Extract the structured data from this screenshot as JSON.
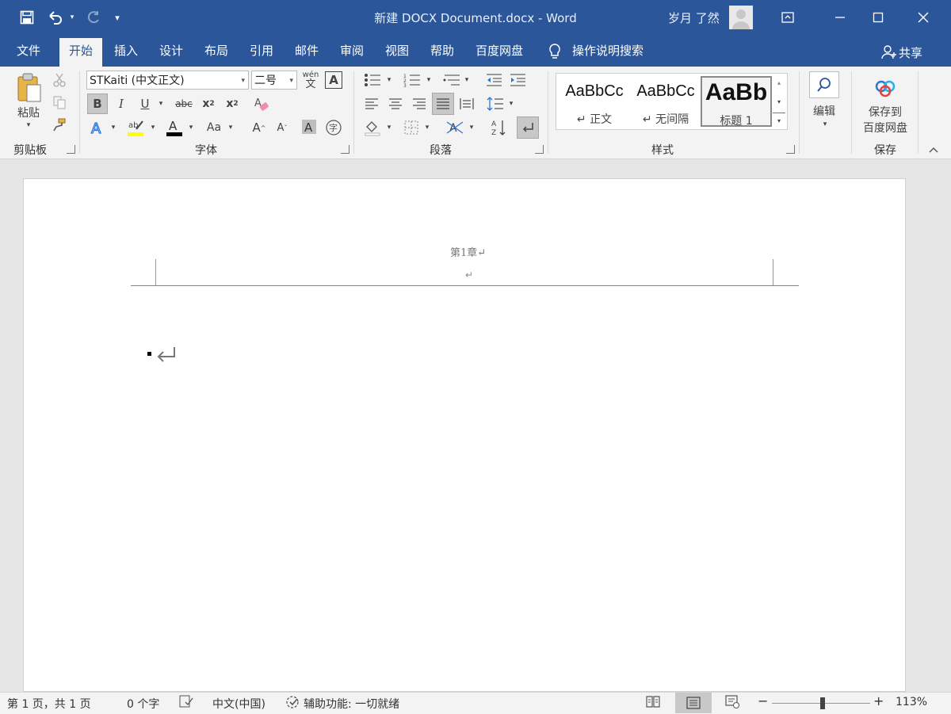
{
  "titlebar": {
    "doc_title": "新建 DOCX Document.docx  -  Word",
    "user_name": "岁月 了然",
    "quick_access": [
      "save-icon",
      "undo-icon",
      "redo-icon",
      "customize-icon"
    ]
  },
  "tabs": [
    {
      "label": "文件"
    },
    {
      "label": "开始",
      "active": true
    },
    {
      "label": "插入"
    },
    {
      "label": "设计"
    },
    {
      "label": "布局"
    },
    {
      "label": "引用"
    },
    {
      "label": "邮件"
    },
    {
      "label": "审阅"
    },
    {
      "label": "视图"
    },
    {
      "label": "帮助"
    },
    {
      "label": "百度网盘"
    }
  ],
  "tell_me": "操作说明搜索",
  "share": "共享",
  "ribbon": {
    "clipboard": {
      "paste": "粘贴",
      "group": "剪贴板"
    },
    "font": {
      "name": "STKaiti (中文正文)",
      "size": "二号",
      "group": "字体",
      "phonetic": "wén",
      "case": "Aa"
    },
    "paragraph": {
      "group": "段落"
    },
    "styles": {
      "group": "样式",
      "items": [
        {
          "sample": "AaBbCc",
          "name": "↵ 正文"
        },
        {
          "sample": "AaBbCc",
          "name": "↵ 无间隔"
        },
        {
          "sample": "AaBb",
          "name": "标题 1"
        }
      ]
    },
    "editing": {
      "label": "编辑"
    },
    "save": {
      "label1": "保存到",
      "label2": "百度网盘",
      "group": "保存"
    }
  },
  "document": {
    "header_text": "第1章↵",
    "header_mark": "↵"
  },
  "status": {
    "page": "第 1 页，共 1 页",
    "words": "0 个字",
    "language": "中文(中国)",
    "accessibility": "辅助功能: 一切就绪",
    "zoom": "113%"
  },
  "colors": {
    "brand": "#2b579a",
    "highlight": "#ffff00",
    "font_color": "#000000"
  }
}
